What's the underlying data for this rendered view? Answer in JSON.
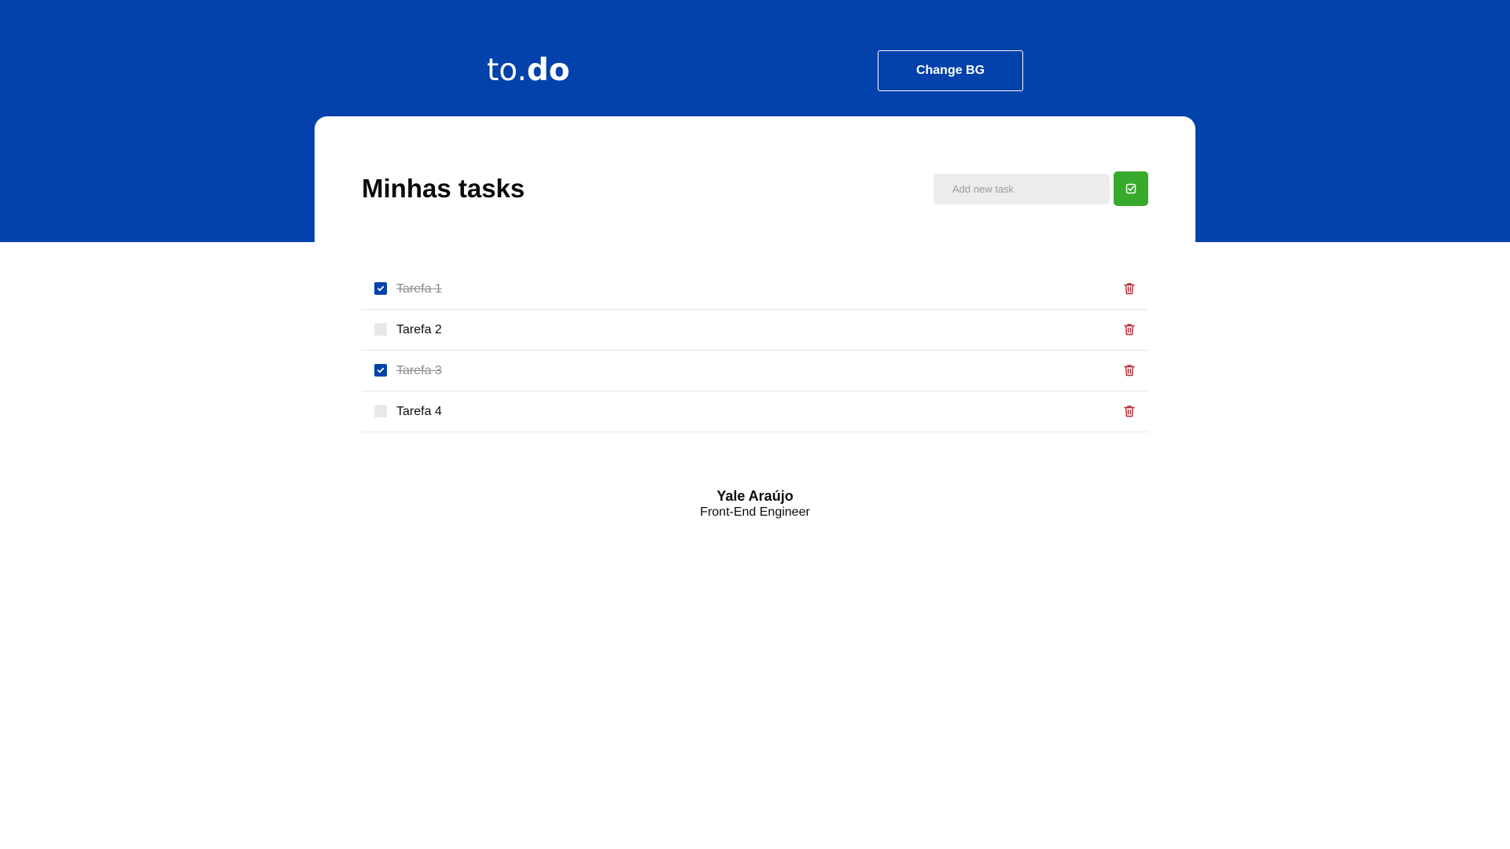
{
  "header": {
    "logo_light": "to.",
    "logo_bold": "do",
    "change_bg_label": "Change BG"
  },
  "main": {
    "title": "Minhas tasks",
    "new_task_placeholder": "Add new task",
    "new_task_value": "",
    "add_icon": "checkbox-check-icon"
  },
  "tasks": [
    {
      "label": "Tarefa 1",
      "done": true
    },
    {
      "label": "Tarefa 2",
      "done": false
    },
    {
      "label": "Tarefa 3",
      "done": true
    },
    {
      "label": "Tarefa 4",
      "done": false
    }
  ],
  "footer": {
    "name": "Yale Araújo",
    "role": "Front-End Engineer"
  },
  "colors": {
    "brand_blue": "#0341ab",
    "add_green": "#38aa2b",
    "trash_red": "#b3262f"
  }
}
